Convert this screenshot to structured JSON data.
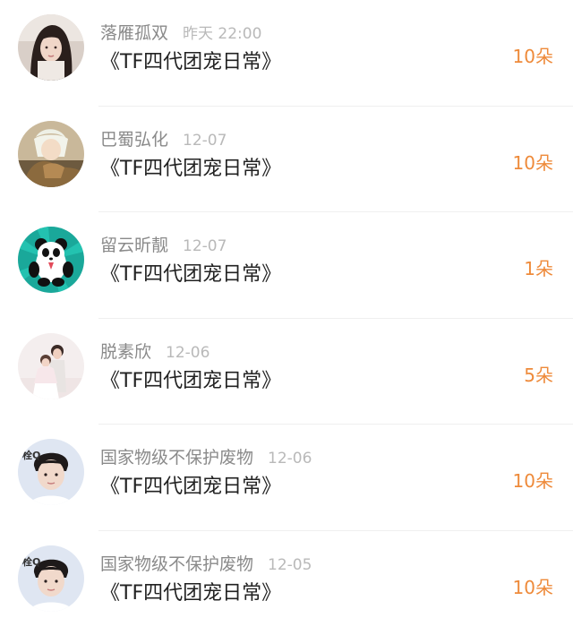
{
  "colors": {
    "accent": "#ee8a3a",
    "name": "#8a8a8a",
    "time": "#b9b9b9",
    "title": "#222222"
  },
  "records": [
    {
      "name": "落雁孤双",
      "time": "昨天 22:00",
      "title": "《TF四代团宠日常》",
      "amount": "10朵",
      "avatar": "woman-portrait-avatar"
    },
    {
      "name": "巴蜀弘化",
      "time": "12-07",
      "title": "《TF四代团宠日常》",
      "amount": "10朵",
      "avatar": "anime-illustration-avatar"
    },
    {
      "name": "留云昕靓",
      "time": "12-07",
      "title": "《TF四代团宠日常》",
      "amount": "1朵",
      "avatar": "panda-cartoon-avatar"
    },
    {
      "name": "脱素欣",
      "time": "12-06",
      "title": "《TF四代团宠日常》",
      "amount": "5朵",
      "avatar": "couple-photo-avatar"
    },
    {
      "name": "国家物级不保护废物",
      "time": "12-06",
      "title": "《TF四代团宠日常》",
      "amount": "10朵",
      "avatar": "boy-photo-avatar",
      "avatar_text": "栓Q"
    },
    {
      "name": "国家物级不保护废物",
      "time": "12-05",
      "title": "《TF四代团宠日常》",
      "amount": "10朵",
      "avatar": "boy-photo-avatar",
      "avatar_text": "栓Q"
    }
  ]
}
